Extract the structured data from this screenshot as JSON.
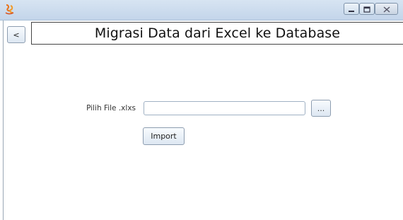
{
  "window": {
    "app_icon": "java-logo-icon",
    "controls": {
      "minimize": "minimize-icon",
      "maximize": "maximize-icon",
      "close": "close-icon"
    }
  },
  "header": {
    "back_label": "<",
    "title": "Migrasi Data dari Excel ke Database"
  },
  "form": {
    "file_label": "Pilih File .xlxs",
    "file_value": "",
    "browse_label": "...",
    "import_label": "Import"
  },
  "colors": {
    "titlebar": "#c9d9ec",
    "border": "#8d9db0",
    "text": "#111111"
  }
}
